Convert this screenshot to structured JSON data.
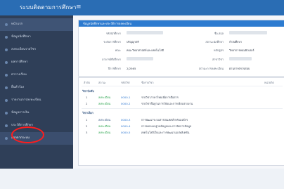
{
  "header": {
    "app_title": "ระบบติดตามการศึกษา",
    "menu_icon": "menu-icon"
  },
  "sidebar": {
    "items": [
      {
        "label": "หน้าแรก"
      },
      {
        "label": "ข้อมูลนักศึกษา"
      },
      {
        "label": "ลงทะเบียนรายวิชา"
      },
      {
        "label": "ผลการศึกษา"
      },
      {
        "label": "ตารางเรียน"
      },
      {
        "label": "ยื่นคำร้อง"
      },
      {
        "label": "รายงานการลงทะเบียน"
      },
      {
        "label": "ข้อมูลการเงิน"
      },
      {
        "label": "ประวัติการศึกษา"
      },
      {
        "label": "ออกจากระบบ"
      }
    ]
  },
  "info_panel": {
    "title": "ข้อมูลนักศึกษาและประวัติการลงทะเบียน",
    "rows": [
      {
        "label": "รหัสนักศึกษา",
        "value": "",
        "label2": "ชื่อ-สกุล",
        "value2": ""
      },
      {
        "label": "ระดับการศึกษา",
        "value": "ปริญญาตรี",
        "label2": "สถานะนักศึกษา",
        "value2": "กำลังศึกษา"
      },
      {
        "label": "คณะ",
        "value": "คณะวิทยาศาสตร์และเทคโนโลยี",
        "label2": "หลักสูตร",
        "value2": "วิทยาการคอมพิวเตอร์"
      },
      {
        "label": "อาจารย์ที่ปรึกษา",
        "value": "",
        "label2": "สาขาวิชา",
        "value2": ""
      },
      {
        "label": "ปีการศึกษา",
        "value": "2/2565",
        "label2": "สถานะการลงทะเบียน",
        "value2": "ผ่านการตรวจสอบ"
      }
    ]
  },
  "table": {
    "headers": [
      "ลำดับ",
      "สถานะ",
      "รหัสวิชา",
      "ชื่อรายวิชา",
      "หน่วยกิต"
    ],
    "groups": [
      {
        "name": "วิชาบังคับ",
        "rows": [
          {
            "no": "1",
            "status": "ลงทะเบียน",
            "code": "0000-1",
            "name": "รายวิชาภาษาไทยเพื่อการสื่อสาร"
          },
          {
            "no": "2",
            "status": "ลงทะเบียน",
            "code": "0000-2",
            "name": "รายวิชาพื้นฐานการวิจัยและการเขียนรายงาน"
          }
        ]
      },
      {
        "name": "วิชาเลือก",
        "rows": [
          {
            "no": "1",
            "status": "ลงทะเบียน",
            "code": "0000-3",
            "name": "การพัฒนาระบบสารสนเทศสำหรับองค์กร"
          },
          {
            "no": "2",
            "status": "ลงทะเบียน",
            "code": "0000-4",
            "name": "การออกแบบฐานข้อมูลและการจัดการข้อมูล"
          },
          {
            "no": "3",
            "status": "ลงทะเบียน",
            "code": "0000-5",
            "name": "เทคโนโลยีเว็บและการพัฒนาแอปพลิเคชัน"
          }
        ]
      }
    ]
  }
}
